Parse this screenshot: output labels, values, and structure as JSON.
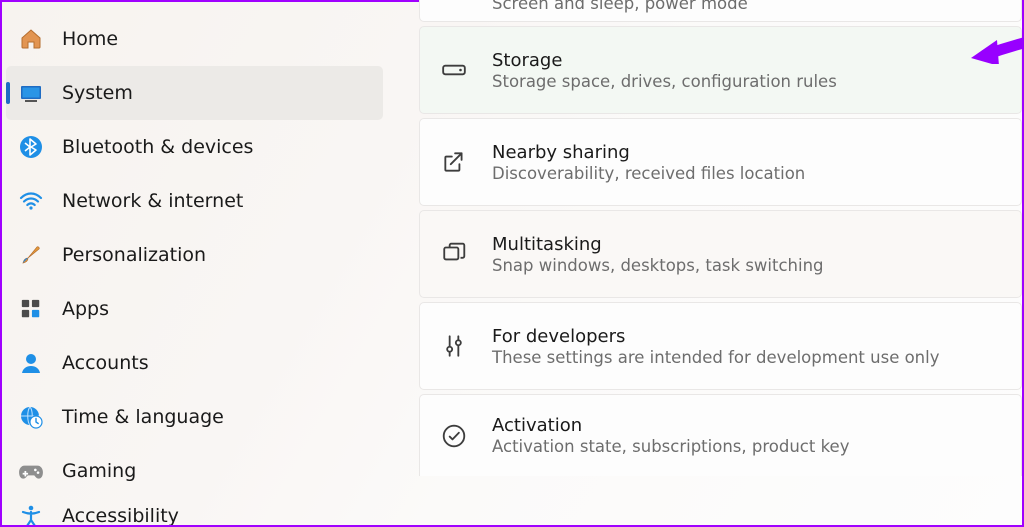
{
  "sidebar": {
    "items": [
      {
        "label": "Home"
      },
      {
        "label": "System"
      },
      {
        "label": "Bluetooth & devices"
      },
      {
        "label": "Network & internet"
      },
      {
        "label": "Personalization"
      },
      {
        "label": "Apps"
      },
      {
        "label": "Accounts"
      },
      {
        "label": "Time & language"
      },
      {
        "label": "Gaming"
      },
      {
        "label": "Accessibility"
      }
    ],
    "selected_index": 1
  },
  "partial_row_top": {
    "sub": "Screen and sleep, power mode"
  },
  "rows": [
    {
      "title": "Storage",
      "sub": "Storage space, drives, configuration rules"
    },
    {
      "title": "Nearby sharing",
      "sub": "Discoverability, received files location"
    },
    {
      "title": "Multitasking",
      "sub": "Snap windows, desktops, task switching"
    },
    {
      "title": "For developers",
      "sub": "These settings are intended for development use only"
    },
    {
      "title": "Activation",
      "sub": "Activation state, subscriptions, product key"
    }
  ],
  "arrow_color": "#9800ff"
}
